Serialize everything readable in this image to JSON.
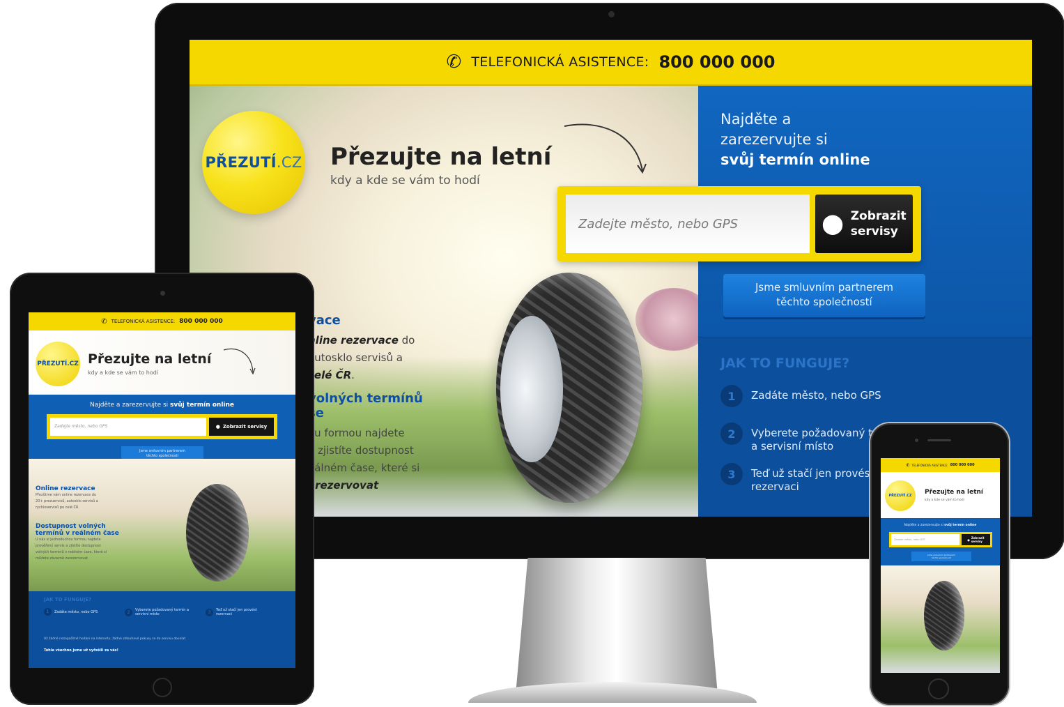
{
  "desktop": {
    "topbar": {
      "label": "TELEFONICKÁ ASISTENCE:",
      "number": "800 000 000",
      "icon": "phone-icon"
    },
    "logo": {
      "main": "PŘEZUTÍ",
      "suffix": ".CZ"
    },
    "hero": {
      "title": "Přezujte na letní",
      "subtitle": "kdy a kde se vám to hodí"
    },
    "search": {
      "placeholder": "Zadejte město, nebo GPS",
      "button_line1": "Zobrazit",
      "button_line2": "servisy",
      "button_icon": "map-pin-icon"
    },
    "right": {
      "headline_line1": "Najděte a",
      "headline_line2": "zarezervujte si",
      "headline_strong": "svůj termín online",
      "cta_line1": "Jsme smluvním partnerem",
      "cta_line2": "těchto společností"
    },
    "features": [
      {
        "title": "vace",
        "text_strong": "nline rezervace",
        "text_tail": " do",
        "line2": "autosklo servisů a",
        "line3_strong": "celé ČR",
        "line3_tail": "."
      },
      {
        "title_line1": "volných termínů",
        "title_line2": "se",
        "line1": "ou formou najdete",
        "line2": "a zjistíte dostupnost",
        "line3": "eálném čase, které si",
        "line4_strong": "arezervovat"
      }
    ],
    "how": {
      "title": "JAK TO FUNGUJE?",
      "steps": [
        {
          "num": "1",
          "text": "Zadáte město, nebo GPS"
        },
        {
          "num": "2",
          "text_line1": "Vyberete požadovaný te",
          "text_line2": "a servisní místo"
        },
        {
          "num": "3",
          "text_line1": "Teď už stačí jen provést",
          "text_line2": "rezervaci"
        }
      ]
    }
  },
  "tablet": {
    "topbar": {
      "label": "TELEFONICKÁ ASISTENCE:",
      "number": "800 000 000"
    },
    "logo": "PŘEZUTÍ.CZ",
    "hero": {
      "title": "Přezujte na letní",
      "subtitle": "kdy a kde se vám to hodí"
    },
    "headline": "Najděte a zarezervujte si",
    "headline_strong": "svůj termín online",
    "search": {
      "placeholder": "Zadejte město, nebo GPS",
      "button": "Zobrazit servisy"
    },
    "cta_line1": "Jsme smluvním partnerem",
    "cta_line2": "těchto společností",
    "features": [
      {
        "title": "Online rezervace",
        "line1": "Přezůtme vám online rezervace do",
        "line2": "20+ prezuervisů, autosklo servisů a",
        "line3": "rychloservisů po celé ČR"
      },
      {
        "title_line1": "Dostupnost volných",
        "title_line2": "termínů v reálném čase",
        "line1": "U nás si jednoduchou formou najdete",
        "line2": "prověřený servis a zjistíte dostupnost",
        "line3": "volných termínů v reálném čase, které si",
        "line4": "můžete závazně zarezervovat"
      }
    ],
    "how": {
      "title": "JAK TO FUNGUJE?",
      "steps": [
        {
          "num": "1",
          "text": "Zadáte město, nebo GPS"
        },
        {
          "num": "2",
          "text": "Vyberete požadovaný termín a servisní místo"
        },
        {
          "num": "3",
          "text": "Teď už stačí jen provést rezervaci"
        }
      ],
      "footer1": "Už žádné nezopačitné hodání na internetu, žádné zdlouhavé pokusy se do servisu dovolat.",
      "footer2": "Tohle všechno jsme už vyřešili za vás!"
    }
  },
  "phone": {
    "topbar": {
      "label": "TELEFONICKÁ ASISTENCE:",
      "number": "800 000 000"
    },
    "logo": "PŘEZUTÍ.CZ",
    "hero": {
      "title": "Přezujte na letní",
      "subtitle": "kdy a kde se vám to hodí"
    },
    "headline": "Najděte a zarezervujte si",
    "headline_strong": "svůj termín online",
    "search": {
      "placeholder": "Zadejte město, nebo GPS",
      "button_line1": "Zobrazit",
      "button_line2": "servisy"
    },
    "cta_line1": "Jsme smluvním partnerem",
    "cta_line2": "těchto společností"
  },
  "colors": {
    "brand_yellow": "#f5d800",
    "brand_blue": "#0f5fb5",
    "dark_blue": "#0b4f9d",
    "logo_blue": "#0d4fa3"
  }
}
